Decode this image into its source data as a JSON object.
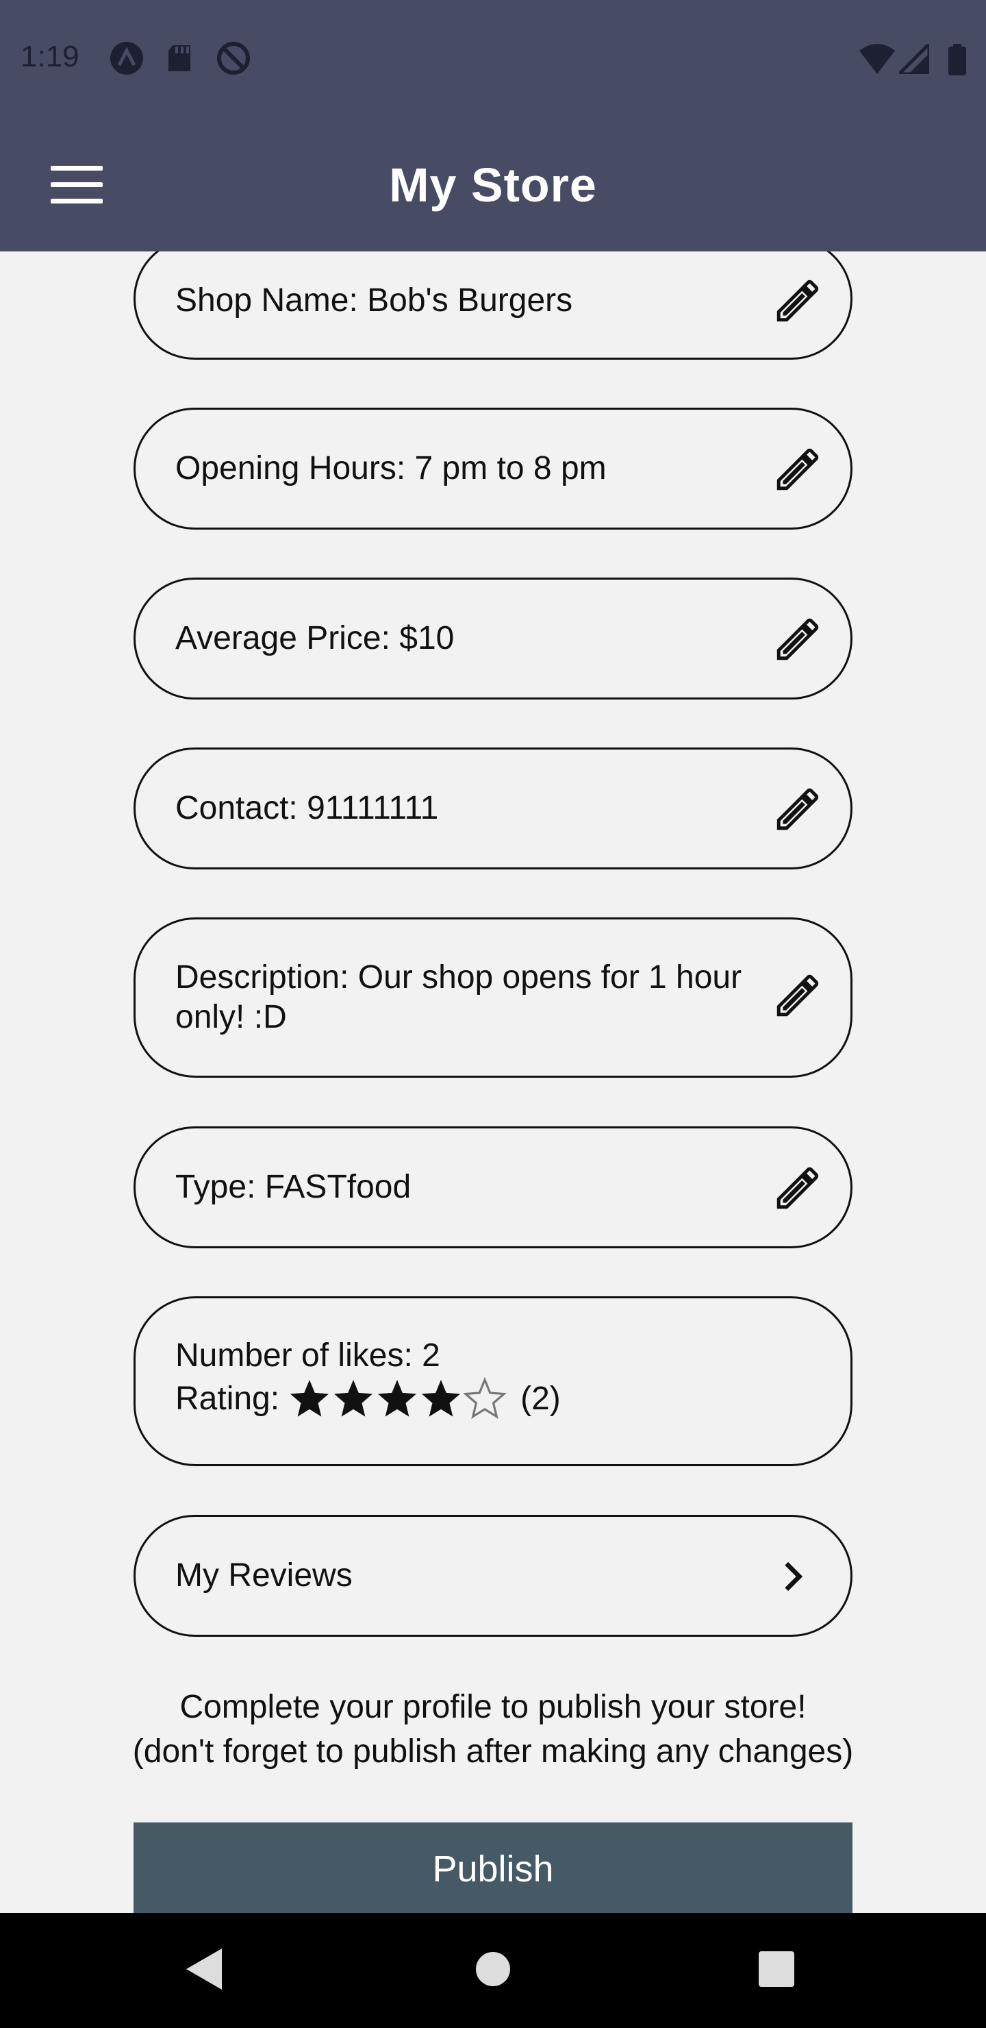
{
  "status_bar": {
    "time": "1:19"
  },
  "app_bar": {
    "title": "My Store"
  },
  "fields": [
    {
      "label": "Shop Name: Bob's Burgers"
    },
    {
      "label": "Opening Hours: 7 pm to 8 pm"
    },
    {
      "label": "Average Price: $10"
    },
    {
      "label": "Contact: 91111111"
    },
    {
      "label_line1": "Description: Our shop opens for 1 hour",
      "label_line2": "only! :D"
    },
    {
      "label": "Type: FASTfood"
    }
  ],
  "stats": {
    "likes_label": "Number of likes: 2",
    "rating_label": "Rating:",
    "rating_value": 4,
    "rating_max": 5,
    "rating_count": "(2)"
  },
  "reviews": {
    "label": "My Reviews"
  },
  "info": {
    "line1": "Complete your profile to publish your store!",
    "line2": "(don't forget to publish after making any changes)"
  },
  "publish": {
    "label": "Publish"
  },
  "icons": [
    "menu-icon",
    "pencil-icon",
    "chevron-right-icon",
    "star-icon",
    "back-icon",
    "home-icon",
    "recents-icon",
    "wifi-icon",
    "signal-icon",
    "battery-icon"
  ],
  "colors": {
    "app_bar": "#474b64",
    "publish_button": "#455a64",
    "background": "#f2f2f2"
  }
}
